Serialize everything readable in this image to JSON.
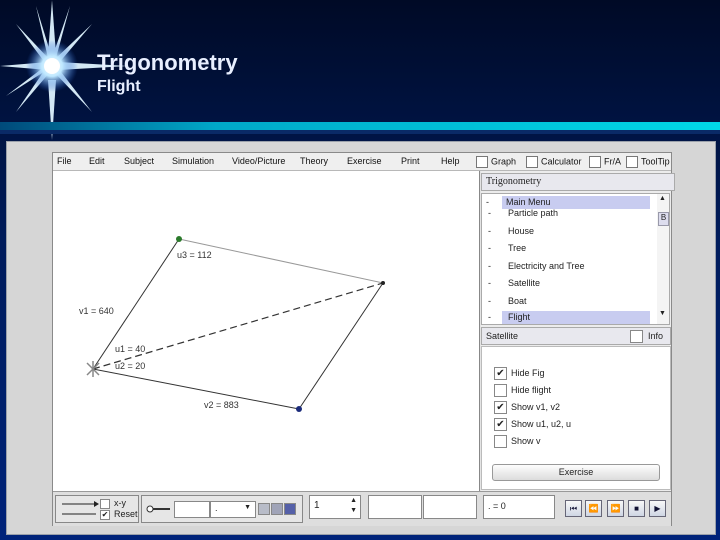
{
  "slide": {
    "title": "Trigonometry",
    "subtitle": "Flight"
  },
  "menu": {
    "items": [
      "File",
      "Edit",
      "Subject",
      "Simulation",
      "Video/Picture",
      "Theory",
      "Exercise",
      "Print",
      "Help"
    ],
    "toggles": [
      "Graph",
      "Calculator",
      "Fr/A",
      "ToolTip"
    ]
  },
  "canvas": {
    "labels": {
      "u3": "u3 = 112",
      "v1": "v1 = 640",
      "u1": "u1 = 40",
      "u2": "u2 = 20",
      "v2": "v2 = 883"
    }
  },
  "panel": {
    "title": "Trigonometry",
    "list": {
      "header": "Main Menu",
      "items": [
        "Particle path",
        "House",
        "Tree",
        "Electricity and Tree",
        "Satellite",
        "Boat",
        "Flight"
      ],
      "dash": "-"
    },
    "section_label": "Satellite",
    "info_label": "Info",
    "options": [
      {
        "label": "Hide Fig",
        "checked": true
      },
      {
        "label": "Hide flight",
        "checked": false
      },
      {
        "label": "Show v1, v2",
        "checked": true
      },
      {
        "label": "Show u1, u2, u",
        "checked": true
      },
      {
        "label": "Show v",
        "checked": false
      }
    ],
    "exercise_button": "Exercise"
  },
  "bottom": {
    "xy_label": "x-y",
    "reset_label": "Reset",
    "dropdown_value": ".",
    "spinner_value": "1",
    "readout": ". = 0",
    "colors": {
      "accent": "#00a8c8",
      "background": "#001c5c"
    }
  },
  "icons": {
    "check": "✔",
    "dropdown": "▼",
    "up": "▲",
    "down": "▼",
    "scroll_up": "▲",
    "scroll_down": "▼",
    "scroll_thumb": "B",
    "transport": [
      "skip-back-icon",
      "rewind-icon",
      "forward-icon",
      "stop-icon",
      "play-icon"
    ]
  }
}
